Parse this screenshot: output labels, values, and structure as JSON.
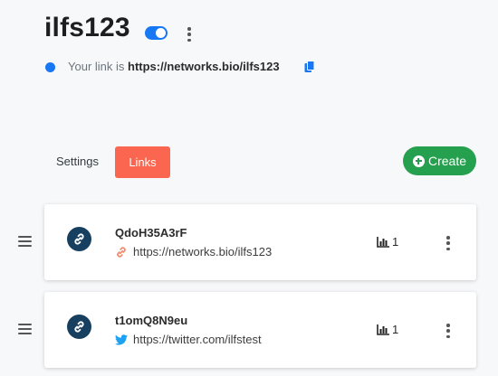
{
  "header": {
    "title": "ilfs123",
    "link_prefix": "Your link is",
    "link_url": "https://networks.bio/ilfs123"
  },
  "tabs": [
    {
      "label": "Settings"
    },
    {
      "label": "Links"
    }
  ],
  "create_button": {
    "label": "Create"
  },
  "links": [
    {
      "name": "QdoH35A3rF",
      "url": "https://networks.bio/ilfs123",
      "url_icon": "link-icon",
      "clicks": "1"
    },
    {
      "name": "t1omQ8N9eu",
      "url": "https://twitter.com/ilfstest",
      "url_icon": "twitter-icon",
      "clicks": "1"
    }
  ],
  "colors": {
    "accent": "#1877f2",
    "links_tab": "#fa6650",
    "create": "#25a04e",
    "avatar": "#173f5f",
    "link_icon": "#f08c6e",
    "twitter": "#1da1f2"
  }
}
